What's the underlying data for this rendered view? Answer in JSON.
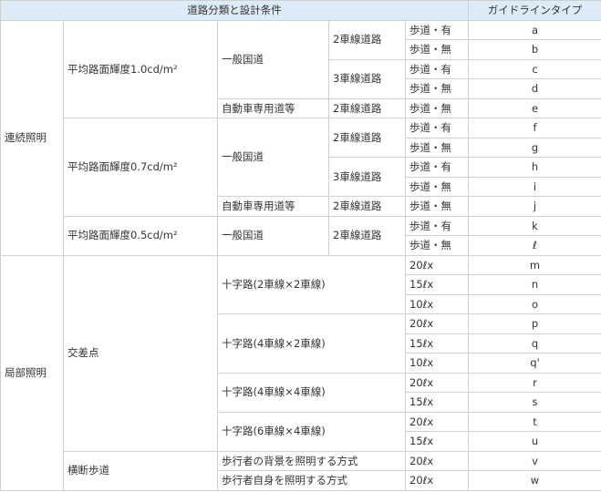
{
  "header": {
    "conditions": "道路分類と設計条件",
    "type": "ガイドラインタイプ"
  },
  "continuous": {
    "label": "連続照明",
    "lum10": "平均路面輝度1.0cd/m²",
    "lum07": "平均路面輝度0.7cd/m²",
    "lum05": "平均路面輝度0.5cd/m²",
    "general_road": "一般国道",
    "expressway": "自動車専用道等",
    "lanes2": "2車線道路",
    "lanes3": "3車線道路",
    "sidewalk_yes": "歩道・有",
    "sidewalk_no": "歩道・無",
    "types": [
      "a",
      "b",
      "c",
      "d",
      "e",
      "f",
      "g",
      "h",
      "i",
      "j",
      "k",
      "ℓ"
    ]
  },
  "local": {
    "label": "局部照明",
    "intersection": "交差点",
    "cross_2x2": "十字路(2車線×2車線)",
    "cross_4x2": "十字路(4車線×2車線)",
    "cross_4x4": "十字路(4車線×4車線)",
    "cross_6x4": "十字路(6車線×4車線)",
    "crosswalk": "横断歩道",
    "bg_method": "歩行者の背景を照明する方式",
    "self_method": "歩行者自身を照明する方式",
    "lx20": "20ℓx",
    "lx15": "15ℓx",
    "lx10": "10ℓx",
    "types": [
      "m",
      "n",
      "o",
      "p",
      "q",
      "q'",
      "r",
      "s",
      "t",
      "u",
      "v",
      "w"
    ]
  }
}
